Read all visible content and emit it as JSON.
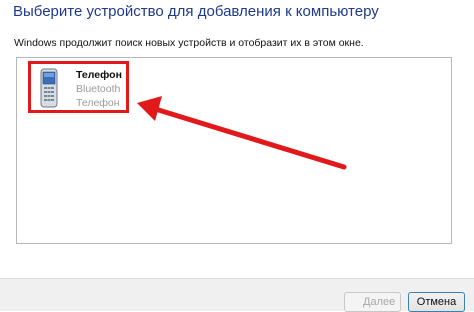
{
  "header": {
    "title": "Выберите устройство для добавления к компьютеру"
  },
  "instruction": "Windows продолжит поиск новых устройств и отобразит их в этом окне.",
  "devices": [
    {
      "name": "Телефон",
      "type": "Bluetooth",
      "category": "Телефон",
      "icon": "mobile-phone-icon"
    }
  ],
  "annotations": {
    "highlight_color": "#e2191b",
    "arrow_color": "#e2191b"
  },
  "footer": {
    "next_label": "Далее",
    "cancel_label": "Отмена"
  }
}
